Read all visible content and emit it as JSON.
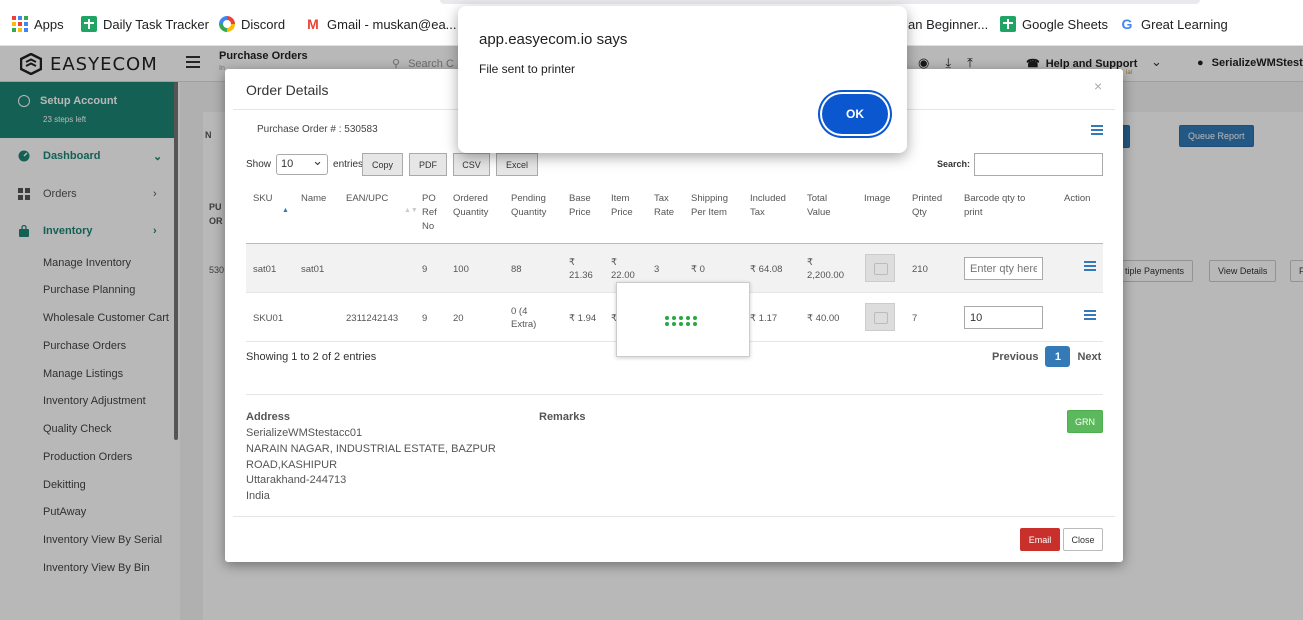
{
  "bookmarks": [
    {
      "label": "Apps",
      "icon": "apps-grid-icon"
    },
    {
      "label": "Daily Task Tracker",
      "icon": "google-sheets-icon"
    },
    {
      "label": "Discord",
      "icon": "discord-icon"
    },
    {
      "label": "Gmail - muskan@ea...",
      "icon": "gmail-icon"
    },
    {
      "label": "an Beginner...",
      "icon": ""
    },
    {
      "label": "Google Sheets",
      "icon": "google-sheets-icon"
    },
    {
      "label": "Great Learning",
      "icon": "google-g-icon"
    }
  ],
  "header": {
    "brand": "EASYECOM",
    "page_title": "Purchase Orders",
    "page_sub": "In",
    "search_placeholder": "Search C",
    "help": "Help and Support",
    "help_sub": "ial",
    "user": "SerializeWMStest"
  },
  "sidebar": {
    "setup_title": "Setup Account",
    "setup_sub": "23 steps left",
    "items": [
      {
        "label": "Dashboard",
        "icon": "dashboard-icon"
      },
      {
        "label": "Orders",
        "icon": "orders-grid-icon"
      },
      {
        "label": "Inventory",
        "icon": "inventory-bag-icon"
      }
    ],
    "sub_items": [
      "Manage Inventory",
      "Purchase Planning",
      "Wholesale Customer Cart",
      "Purchase Orders",
      "Manage Listings",
      "Inventory Adjustment",
      "Quality Check",
      "Production Orders",
      "Dekitting",
      "PutAway",
      "Inventory View By Serial",
      "Inventory View By Bin"
    ]
  },
  "background": {
    "queue_report": "Queue Report",
    "multiple_payments": "tiple Payments",
    "view_details": "View Details",
    "frag_n": "N",
    "frag_pu": "PU",
    "frag_or": "OR",
    "frag_530": "530",
    "frag_f": "F"
  },
  "modal": {
    "title": "Order Details",
    "close": "×",
    "po_label": "Purchase Order # :",
    "po_number": "530583",
    "show_label": "Show",
    "show_value": "10",
    "entries_label": "entries",
    "buttons": [
      "Copy",
      "PDF",
      "CSV",
      "Excel"
    ],
    "search_label": "Search:",
    "columns": [
      "SKU",
      "Name",
      "EAN/UPC",
      "PO Ref No",
      "Ordered Quantity",
      "Pending Quantity",
      "Base Price",
      "Item Price",
      "Tax Rate",
      "Shipping Per Item",
      "Included Tax",
      "Total Value",
      "Image",
      "Printed Qty",
      "Barcode qty to print",
      "Action"
    ],
    "rows": [
      {
        "sku": "sat01",
        "name": "sat01",
        "ean": "",
        "po_ref": "9",
        "ordered": "100",
        "pending": "88",
        "base_price": "₹ 21.36",
        "item_price": "₹ 22.00",
        "tax_rate": "3",
        "shipping": "₹ 0",
        "included_tax": "₹ 64.08",
        "total_value": "₹ 2,200.00",
        "printed_qty": "210",
        "barcode_qty": "",
        "barcode_placeholder": "Enter qty here"
      },
      {
        "sku": "SKU01",
        "name": "",
        "ean": "2311242143",
        "po_ref": "9",
        "ordered": "20",
        "pending": "0 (4 Extra)",
        "base_price": "₹ 1.94",
        "item_price": "₹",
        "tax_rate": "",
        "shipping": "",
        "included_tax": "₹ 1.17",
        "total_value": "₹ 40.00",
        "printed_qty": "7",
        "barcode_qty": "10",
        "barcode_placeholder": ""
      }
    ],
    "showing_text": "Showing 1 to 2 of 2 entries",
    "pagination": {
      "previous": "Previous",
      "current": "1",
      "next": "Next"
    },
    "address_label": "Address",
    "address_lines": [
      "SerializeWMStestacc01",
      "NARAIN NAGAR, INDUSTRIAL ESTATE, BAZPUR",
      "ROAD,KASHIPUR",
      "Uttarakhand-244713",
      "India"
    ],
    "remarks_label": "Remarks",
    "grn_label": "GRN",
    "email_label": "Email",
    "close_label": "Close"
  },
  "alert": {
    "title": "app.easyecom.io says",
    "message": "File sent to printer",
    "ok": "OK"
  },
  "colors": {
    "teal": "#1e8577",
    "primary": "#337ab7",
    "success": "#5cb85c",
    "danger": "#c9302c",
    "chrome_blue": "#0b57d0"
  }
}
